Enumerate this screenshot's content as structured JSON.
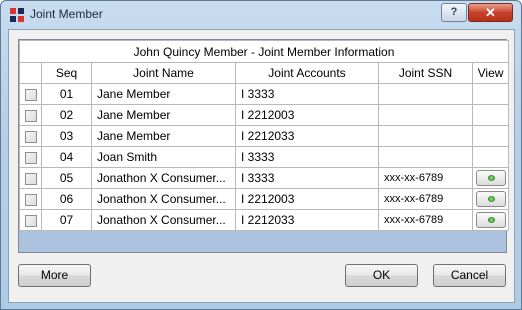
{
  "window": {
    "title": "Joint Member",
    "help_label": "?",
    "close_label": "✕"
  },
  "grid": {
    "caption": "John Quincy Member - Joint Member Information",
    "columns": {
      "seq": "Seq",
      "name": "Joint Name",
      "accounts": "Joint Accounts",
      "ssn": "Joint SSN",
      "view": "View"
    },
    "rows": [
      {
        "seq": "01",
        "name": "Jane Member",
        "accounts": "I 3333",
        "ssn": "",
        "has_view": false,
        "selected": true
      },
      {
        "seq": "02",
        "name": "Jane Member",
        "accounts": "I 2212003",
        "ssn": "",
        "has_view": false,
        "selected": false
      },
      {
        "seq": "03",
        "name": "Jane Member",
        "accounts": "I 2212033",
        "ssn": "",
        "has_view": false,
        "selected": false
      },
      {
        "seq": "04",
        "name": "Joan Smith",
        "accounts": "I 3333",
        "ssn": "",
        "has_view": false,
        "selected": false
      },
      {
        "seq": "05",
        "name": "Jonathon X Consumer...",
        "accounts": "I 3333",
        "ssn": "xxx-xx-6789",
        "has_view": true,
        "selected": false
      },
      {
        "seq": "06",
        "name": "Jonathon X Consumer...",
        "accounts": "I 2212003",
        "ssn": "xxx-xx-6789",
        "has_view": true,
        "selected": false
      },
      {
        "seq": "07",
        "name": "Jonathon X Consumer...",
        "accounts": "I 2212033",
        "ssn": "xxx-xx-6789",
        "has_view": true,
        "selected": false
      }
    ]
  },
  "buttons": {
    "more": "More",
    "ok": "OK",
    "cancel": "Cancel"
  },
  "icons": {
    "app": "app-icon",
    "view": "eye-icon"
  }
}
